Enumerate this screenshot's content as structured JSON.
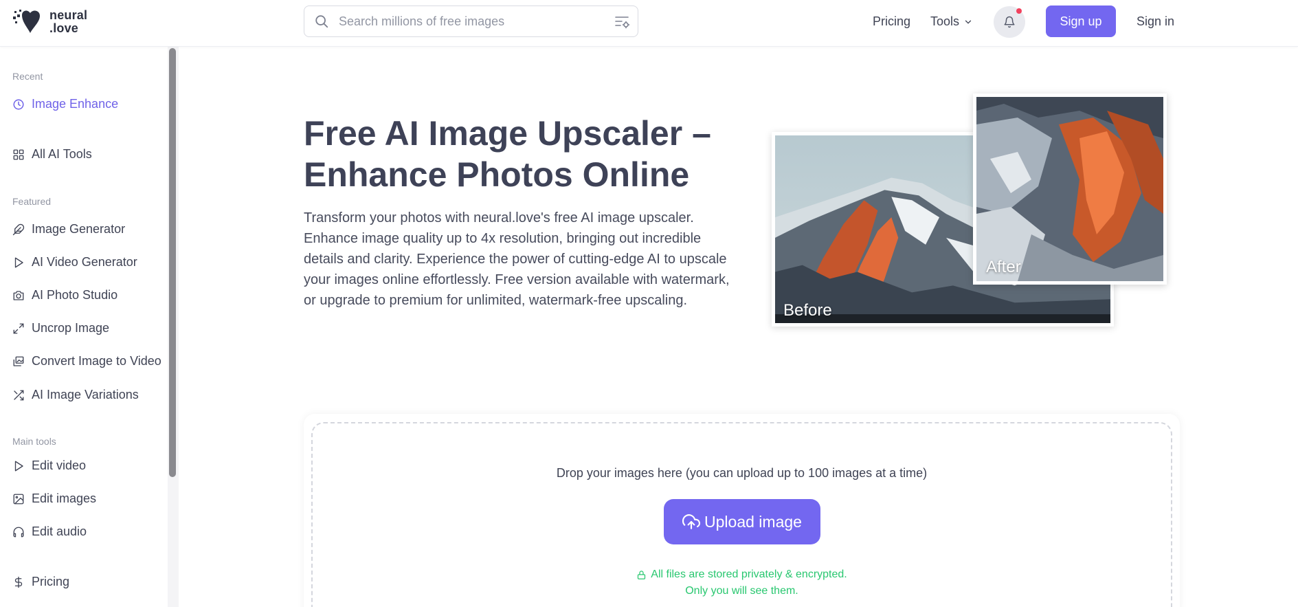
{
  "header": {
    "logo_line1": "neural",
    "logo_line2": ".love",
    "search_placeholder": "Search millions of free images",
    "nav_pricing": "Pricing",
    "nav_tools": "Tools",
    "signup_label": "Sign up",
    "signin_label": "Sign in",
    "accent_color": "#7367f0",
    "notification_dot_color": "#f2415d"
  },
  "sidebar": {
    "recent_label": "Recent",
    "recent_items": [
      {
        "label": "Image Enhance",
        "icon": "clock-icon",
        "active": true
      }
    ],
    "all_tools_label": "All AI Tools",
    "featured_label": "Featured",
    "featured_items": [
      {
        "label": "Image Generator",
        "icon": "feather-icon"
      },
      {
        "label": "AI Video Generator",
        "icon": "play-icon"
      },
      {
        "label": "AI Photo Studio",
        "icon": "camera-icon"
      },
      {
        "label": "Uncrop Image",
        "icon": "expand-icon"
      },
      {
        "label": "Convert Image to Video",
        "icon": "images-icon"
      },
      {
        "label": "AI Image Variations",
        "icon": "shuffle-icon"
      }
    ],
    "main_tools_label": "Main tools",
    "main_items": [
      {
        "label": "Edit video",
        "icon": "play-icon"
      },
      {
        "label": "Edit images",
        "icon": "image-icon"
      },
      {
        "label": "Edit audio",
        "icon": "headphones-icon"
      }
    ],
    "pricing_label": "Pricing"
  },
  "hero": {
    "title_line1": "Free AI Image Upscaler –",
    "title_line2": "Enhance Photos Online",
    "description": "Transform your photos with neural.love's free AI image upscaler. Enhance image quality up to 4x resolution, bringing out incredible details and clarity. Experience the power of cutting-edge AI to upscale your images online effortlessly. Free version available with watermark, or upgrade to premium for unlimited, watermark-free upscaling.",
    "before_label": "Before",
    "after_label": "After"
  },
  "upload": {
    "drop_text": "Drop your images here (you can upload up to 100 images at a time)",
    "button_label": "Upload image",
    "secure_line1": "All files are stored privately & encrypted.",
    "secure_line2": "Only you will see them.",
    "secure_color": "#28c76f"
  }
}
